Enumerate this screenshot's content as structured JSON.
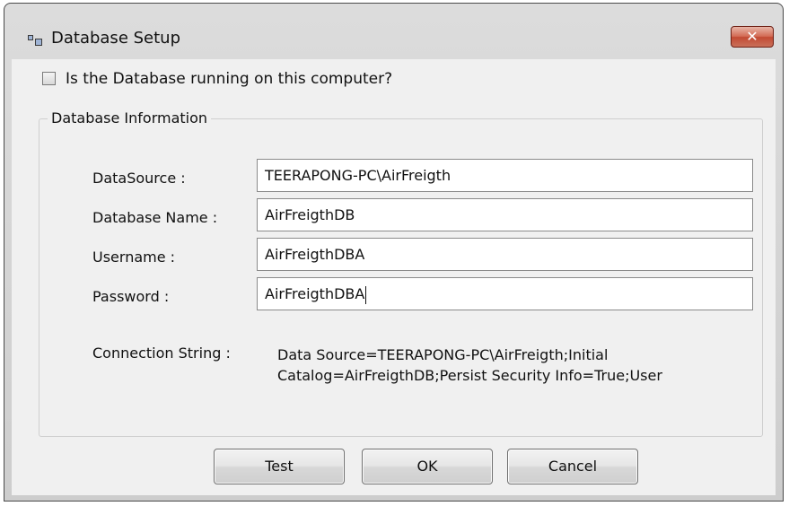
{
  "window": {
    "title": "Database Setup",
    "close_glyph": "✕"
  },
  "local_db_checkbox": {
    "label": "Is the Database running on this computer?",
    "checked": false
  },
  "group": {
    "legend": "Database Information",
    "fields": [
      {
        "label": "DataSource :",
        "value": "TEERAPONG-PC\\AirFreigth"
      },
      {
        "label": "Database Name :",
        "value": "AirFreigthDB"
      },
      {
        "label": "Username :",
        "value": "AirFreigthDBA"
      },
      {
        "label": "Password :",
        "value": "AirFreigthDBA"
      }
    ],
    "connection_string_label": "Connection String :",
    "connection_string_value": "Data Source=TEERAPONG-PC\\AirFreigth;Initial Catalog=AirFreigthDB;Persist Security Info=True;User"
  },
  "buttons": {
    "test": "Test",
    "ok": "OK",
    "cancel": "Cancel"
  },
  "icons": {
    "app": "database-setup-icon",
    "close": "close-icon",
    "checkbox": "checkbox-unchecked-icon"
  }
}
